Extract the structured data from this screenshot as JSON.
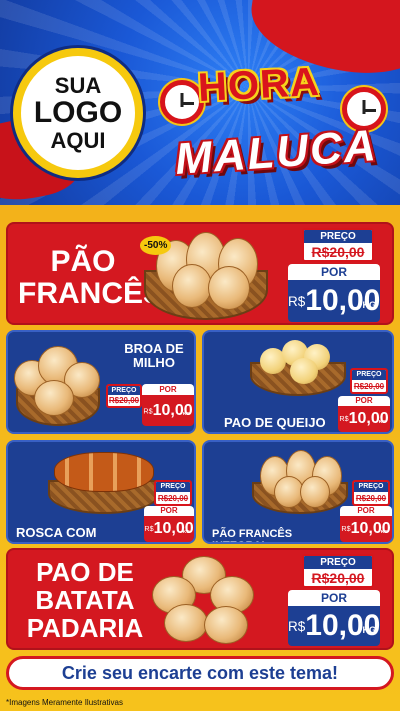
{
  "header": {
    "logo_lines": [
      "SUA",
      "LOGO",
      "AQUI"
    ],
    "headline_top": "HORA",
    "headline_bottom": "MALUCA"
  },
  "featured_top": {
    "name_lines": [
      "PÃO",
      "FRANCÊS"
    ],
    "discount_badge": "-50%",
    "price_label": "PREÇO",
    "old_price": "R$20,00",
    "now_label": "POR",
    "currency": "R$",
    "price": "10,00",
    "unit": "KG"
  },
  "grid": [
    {
      "name": "BROA DE MILHO",
      "price_label": "PREÇO",
      "old_price": "R$20,00",
      "now_label": "POR",
      "currency": "R$",
      "price": "10,00",
      "unit": "KG"
    },
    {
      "name": "PAO DE QUEIJO",
      "price_label": "PREÇO",
      "old_price": "R$20,00",
      "now_label": "POR",
      "currency": "R$",
      "price": "10,00",
      "unit": "KG"
    },
    {
      "name": "ROSCA COM CREME",
      "price_label": "PREÇO",
      "old_price": "R$20,00",
      "now_label": "POR",
      "currency": "R$",
      "price": "10,00",
      "unit": "KG"
    },
    {
      "name": "PÃO FRANCÊS INTEGRAL",
      "price_label": "PREÇO",
      "old_price": "R$20,00",
      "now_label": "POR",
      "currency": "R$",
      "price": "10,00",
      "unit": "KG"
    }
  ],
  "featured_bottom": {
    "name_lines": [
      "PAO DE",
      "BATATA",
      "PADARIA"
    ],
    "price_label": "PREÇO",
    "old_price": "R$20,00",
    "now_label": "POR",
    "currency": "R$",
    "price": "10,00",
    "unit": "KG"
  },
  "footer": {
    "cta": "Crie seu encarte com este tema!",
    "disclaimer": "*Imagens Meramente Ilustrativas"
  },
  "colors": {
    "brand_red": "#d41820",
    "brand_navy": "#1d3f93",
    "brand_yellow": "#f6c21c",
    "header_blue": "#1a58d6"
  }
}
